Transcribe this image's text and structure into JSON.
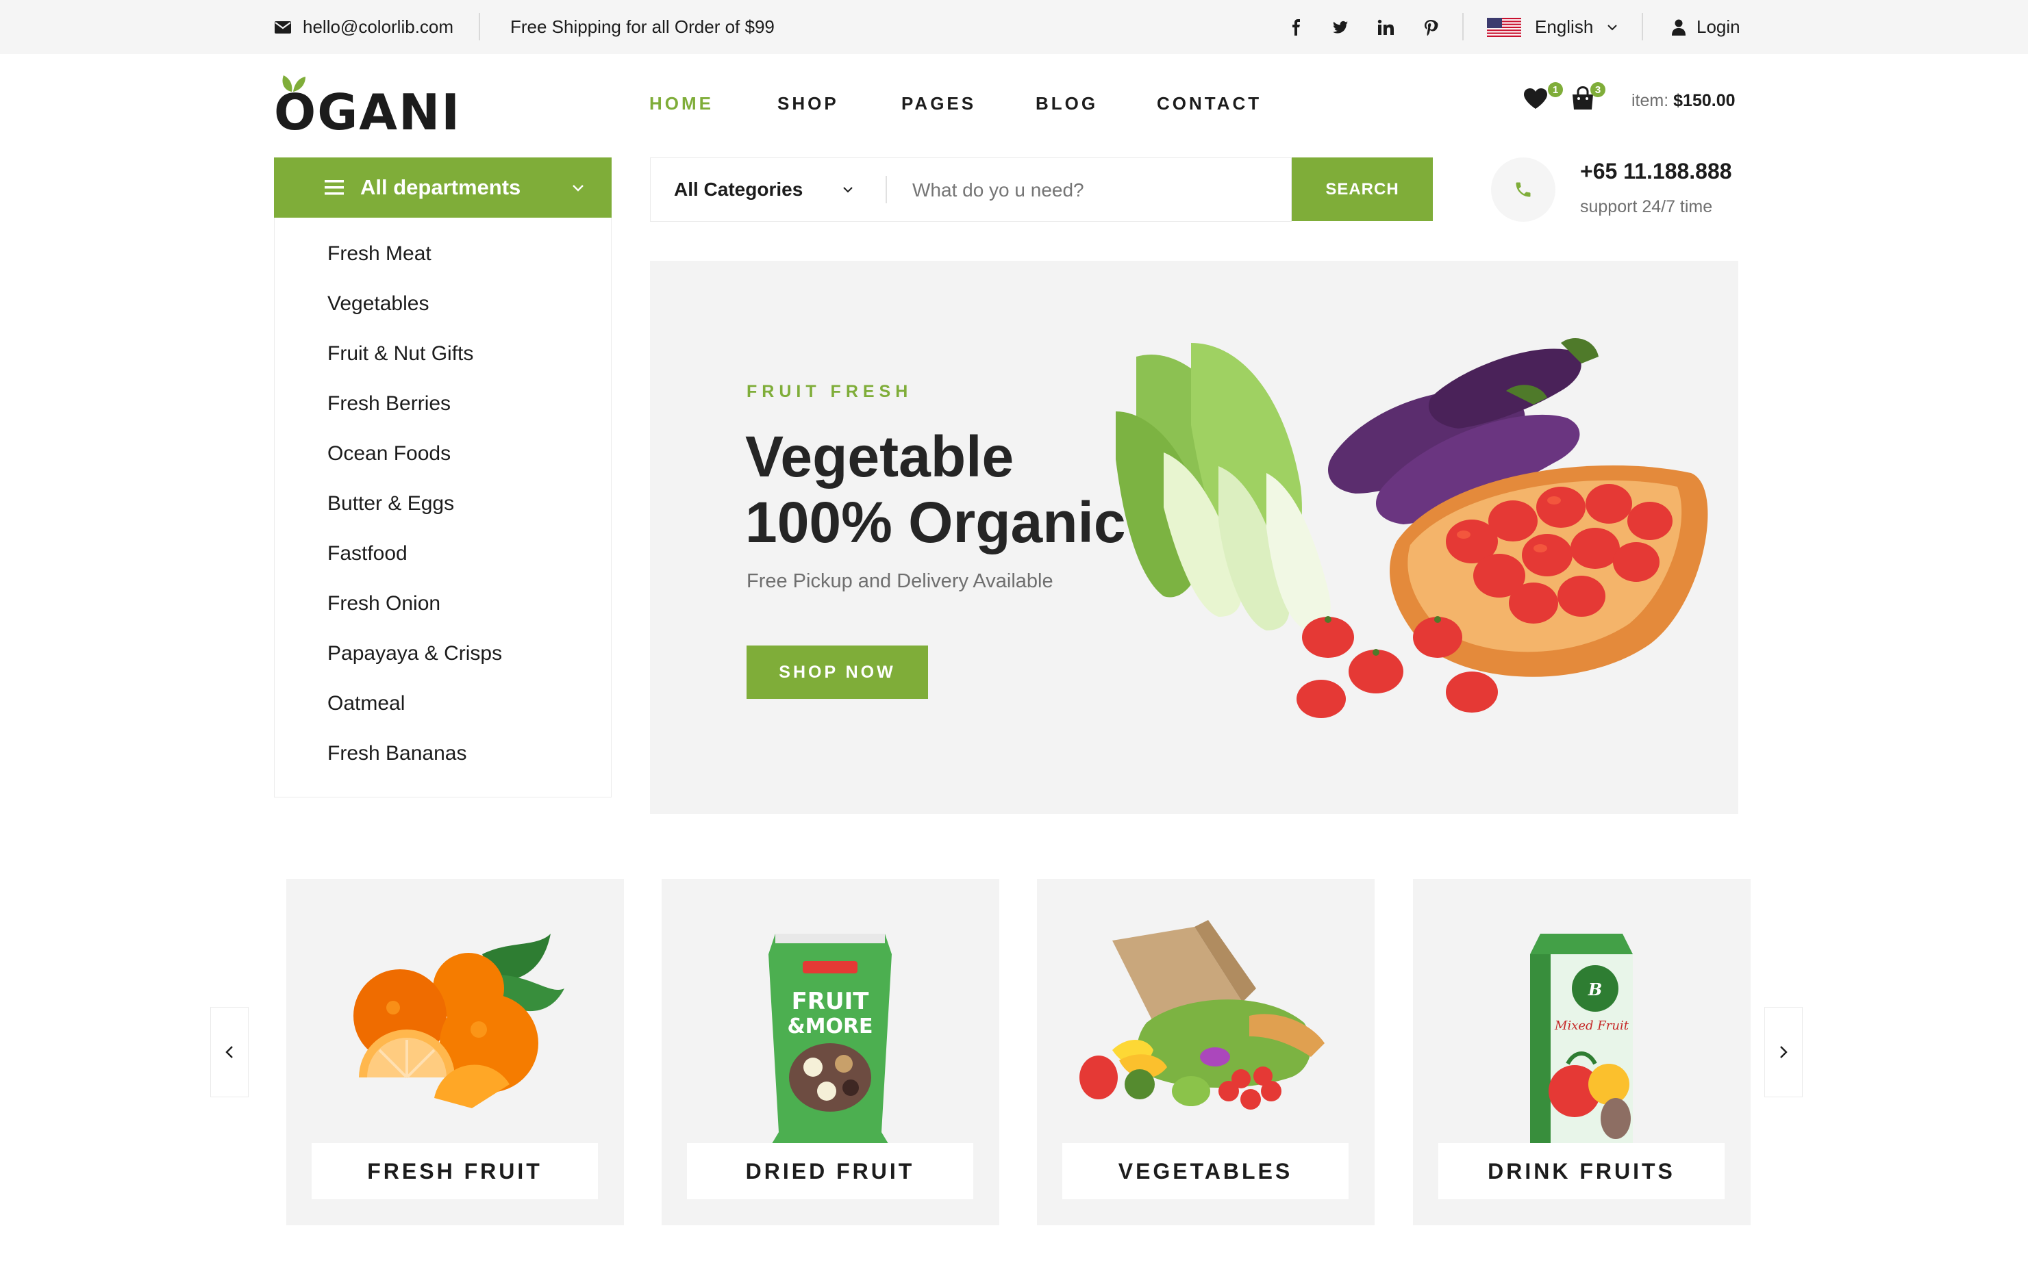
{
  "topbar": {
    "email": "hello@colorlib.com",
    "shipping": "Free Shipping for all Order of $99",
    "language": "English",
    "login": "Login",
    "social_icons": [
      "facebook-icon",
      "twitter-icon",
      "linkedin-icon",
      "pinterest-icon"
    ]
  },
  "header": {
    "logo": "OGANI",
    "nav": [
      "HOME",
      "SHOP",
      "PAGES",
      "BLOG",
      "CONTACT"
    ],
    "active_nav": "HOME",
    "wishlist_count": "1",
    "cart_count": "3",
    "item_label": "item:",
    "item_total": "$150.00"
  },
  "departments": {
    "title": "All departments",
    "items": [
      "Fresh Meat",
      "Vegetables",
      "Fruit & Nut Gifts",
      "Fresh Berries",
      "Ocean Foods",
      "Butter & Eggs",
      "Fastfood",
      "Fresh Onion",
      "Papayaya & Crisps",
      "Oatmeal",
      "Fresh Bananas"
    ]
  },
  "search": {
    "category": "All Categories",
    "placeholder": "What do yo u need?",
    "button": "SEARCH"
  },
  "contact": {
    "phone": "+65 11.188.888",
    "support": "support 24/7 time"
  },
  "hero": {
    "eyebrow": "FRUIT FRESH",
    "title_line1": "Vegetable",
    "title_line2": "100% Organic",
    "subtitle": "Free Pickup and Delivery Available",
    "button": "SHOP NOW"
  },
  "categories": [
    {
      "label": "FRESH FRUIT"
    },
    {
      "label": "DRIED FRUIT"
    },
    {
      "label": "VEGETABLES"
    },
    {
      "label": "DRINK FRUITS"
    }
  ],
  "colors": {
    "accent": "#7fad39",
    "text": "#1c1c1c",
    "muted": "#6f6f6f",
    "panel": "#f3f3f3"
  }
}
